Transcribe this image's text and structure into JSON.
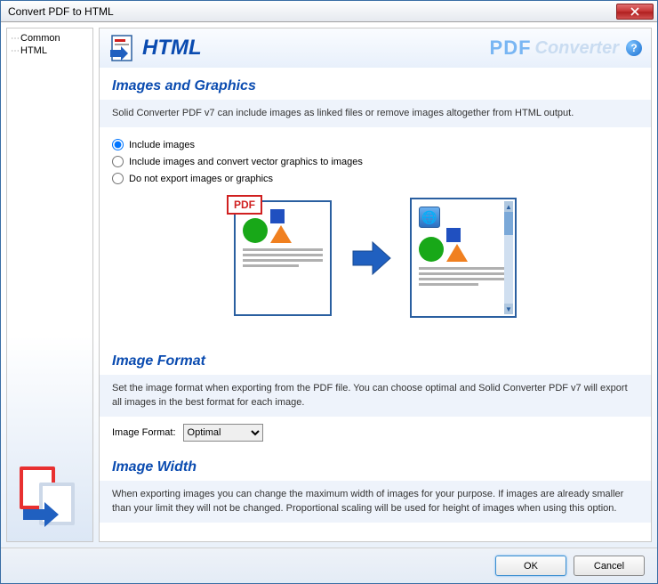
{
  "window": {
    "title": "Convert PDF to HTML"
  },
  "sidebar": {
    "items": [
      "Common",
      "HTML"
    ]
  },
  "header": {
    "title": "HTML",
    "brand_pdf": "PDF",
    "brand_conv": "Converter"
  },
  "sections": {
    "images": {
      "title": "Images and Graphics",
      "desc": "Solid Converter PDF v7 can include images as linked files or remove images altogether from HTML output.",
      "options": [
        "Include images",
        "Include images and convert vector graphics to images",
        "Do not export  images or graphics"
      ],
      "selected": 0,
      "pdf_badge": "PDF"
    },
    "format": {
      "title": "Image Format",
      "desc": "Set the image format when exporting from the PDF file. You can choose optimal and Solid Converter PDF v7 will export all images in the best format for each image.",
      "label": "Image Format:",
      "value": "Optimal"
    },
    "width": {
      "title": "Image Width",
      "desc": "When exporting images you can change the maximum width of images for your purpose. If images are already smaller than your limit they will not be changed. Proportional scaling will be used for height of images when using this option."
    }
  },
  "footer": {
    "ok": "OK",
    "cancel": "Cancel"
  }
}
